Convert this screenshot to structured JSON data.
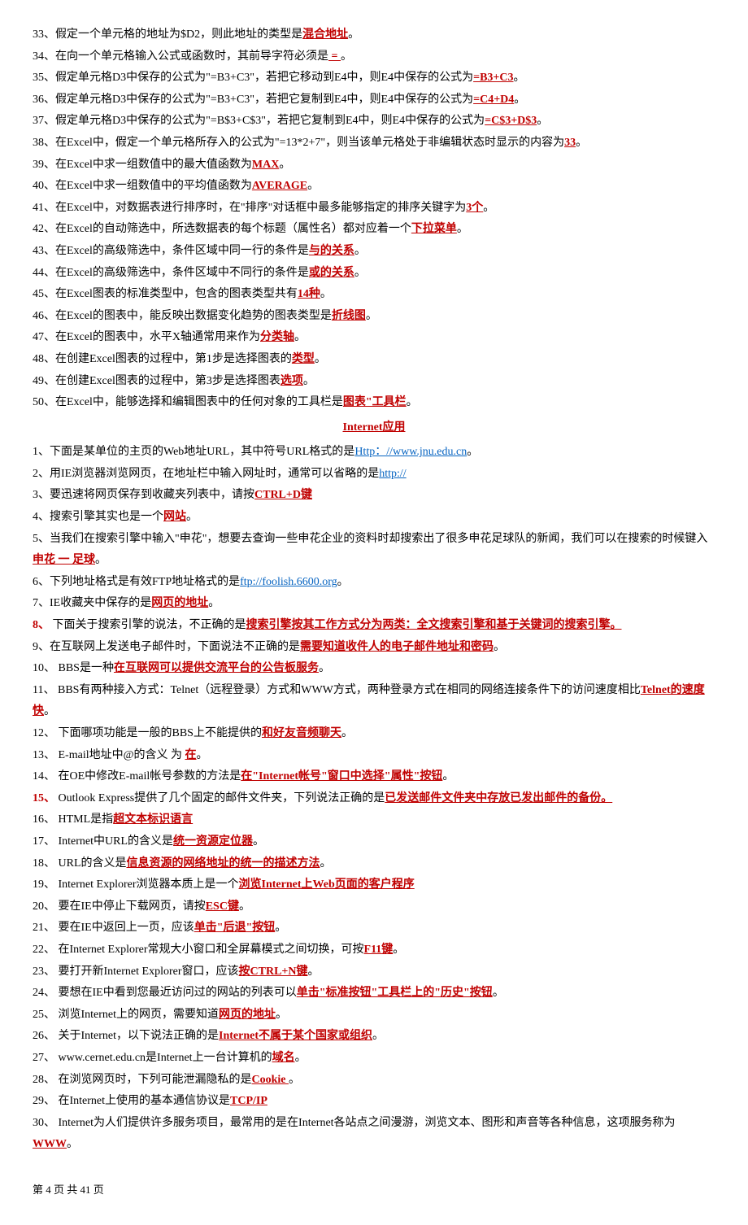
{
  "excel": [
    {
      "n": "33",
      "pre": "假定一个单元格的地址为$D2，则此地址的类型是",
      "ans": "混合地址",
      "post": "。"
    },
    {
      "n": "34",
      "pre": "在向一个单元格输入公式或函数时，其前导字符必须是",
      "ans": " = ",
      "post": "。"
    },
    {
      "n": "35",
      "pre": "假定单元格D3中保存的公式为\"=B3+C3\"，若把它移动到E4中，则E4中保存的公式为",
      "ans": "=B3+C3",
      "post": "。"
    },
    {
      "n": "36",
      "pre": "假定单元格D3中保存的公式为\"=B3+C3\"，若把它复制到E4中，则E4中保存的公式为",
      "ans": "=C4+D4",
      "post": "。"
    },
    {
      "n": "37",
      "pre": "假定单元格D3中保存的公式为\"=B$3+C$3\"，若把它复制到E4中，则E4中保存的公式为",
      "ans": "=C$3+D$3",
      "post": "。"
    },
    {
      "n": "38",
      "pre": "在Excel中，假定一个单元格所存入的公式为\"=13*2+7\"，则当该单元格处于非编辑状态时显示的内容为",
      "ans": "33",
      "post": "。"
    },
    {
      "n": "39",
      "pre": "在Excel中求一组数值中的最大值函数为",
      "ans": "MAX",
      "post": "。"
    },
    {
      "n": "40",
      "pre": "在Excel中求一组数值中的平均值函数为",
      "ans": "AVERAGE",
      "post": "。"
    },
    {
      "n": "41",
      "pre": "在Excel中，对数据表进行排序时，在\"排序\"对话框中最多能够指定的排序关键字为",
      "ans": "3个",
      "post": "。"
    },
    {
      "n": "42",
      "pre": "在Excel的自动筛选中，所选数据表的每个标题（属性名）都对应着一个",
      "ans": "下拉菜单",
      "post": "。"
    },
    {
      "n": "43",
      "pre": "在Excel的高级筛选中，条件区域中同一行的条件是",
      "ans": "与的关系",
      "post": "。"
    },
    {
      "n": "44",
      "pre": "在Excel的高级筛选中，条件区域中不同行的条件是",
      "ans": "或的关系",
      "post": "。"
    },
    {
      "n": "45",
      "pre": "在Excel图表的标准类型中，包含的图表类型共有",
      "ans": "14种",
      "post": "。"
    },
    {
      "n": "46",
      "pre": "在Excel的图表中，能反映出数据变化趋势的图表类型是",
      "ans": "折线图",
      "post": "。"
    },
    {
      "n": "47",
      "pre": "在Excel的图表中，水平X轴通常用来作为",
      "ans": "分类轴",
      "post": "。"
    },
    {
      "n": "48",
      "pre": "在创建Excel图表的过程中，第1步是选择图表的",
      "ans": "类型",
      "post": "。"
    },
    {
      "n": "49",
      "pre": "在创建Excel图表的过程中，第3步是选择图表",
      "ans": "选项",
      "post": "。"
    },
    {
      "n": "50",
      "pre": "在Excel中，能够选择和编辑图表中的任何对象的工具栏是",
      "ans": "图表\"工具栏",
      "post": "。"
    }
  ],
  "section_title": "Internet应用",
  "net": [
    {
      "n": "1",
      "pre": "下面是某单位的主页的Web地址URL，其中符号URL格式的是",
      "ans": "Http：//www.jnu.edu.cn",
      "post": "。",
      "linkStyle": "blue"
    },
    {
      "n": "2",
      "pre": "用IE浏览器浏览网页，在地址栏中输入网址时，通常可以省略的是",
      "ans": "http://",
      "post": "",
      "linkStyle": "blue"
    },
    {
      "n": "3",
      "pre": "要迅速将网页保存到收藏夹列表中，请按",
      "ans": "CTRL+D键",
      "post": ""
    },
    {
      "n": "4",
      "pre": "搜索引擎其实也是一个",
      "ans": "网站",
      "post": "。"
    },
    {
      "n": "5",
      "pre": "当我们在搜索引擎中输入\"申花\"，想要去查询一些申花企业的资料时却搜索出了很多申花足球队的新闻，我们可以在搜索的时候键入",
      "ans": "申花 一 足球",
      "post": "。"
    },
    {
      "n": "6",
      "pre": "下列地址格式是有效FTP地址格式的是",
      "ans": "ftp://foolish.6600.org",
      "post": "。",
      "linkStyle": "blue"
    },
    {
      "n": "7",
      "pre": "IE收藏夹中保存的是",
      "ans": "网页的地址",
      "post": "。"
    },
    {
      "n": "8",
      "numRed": true,
      "pre": " 下面关于搜索引擎的说法，不正确的是",
      "ans": "搜索引擎按其工作方式分为两类：全文搜索引擎和基于关键词的搜索引擎。",
      "post": ""
    },
    {
      "n": "9",
      "pre": "在互联网上发送电子邮件时，下面说法不正确的是",
      "ans": "需要知道收件人的电子邮件地址和密码",
      "post": "。"
    },
    {
      "n": "10",
      "pre": " BBS是一种",
      "ans": "在互联网可以提供交流平台的公告板服务",
      "post": "。"
    },
    {
      "n": "11",
      "pre": " BBS有两种接入方式：Telnet（远程登录）方式和WWW方式，两种登录方式在相同的网络连接条件下的访问速度相比",
      "ans": "Telnet的速度快",
      "post": "。"
    },
    {
      "n": "12",
      "pre": " 下面哪项功能是一般的BBS上不能提供的",
      "ans": "和好友音频聊天",
      "post": "。"
    },
    {
      "n": "13",
      "pre": " E-mail地址中@的含义 为 ",
      "ans": "在",
      "post": "。"
    },
    {
      "n": "14",
      "pre": " 在OE中修改E-mail帐号参数的方法是",
      "ans": "在\"Internet帐号\"窗口中选择\"属性\"按钮",
      "post": "。"
    },
    {
      "n": "15",
      "numRed": true,
      "pre": " Outlook Express提供了几个固定的邮件文件夹，下列说法正确的是",
      "ans": "已发送邮件文件夹中存放已发出邮件的备份。 ",
      "post": ""
    },
    {
      "n": "16",
      "pre": " HTML是指",
      "ans": "超文本标识语言",
      "post": ""
    },
    {
      "n": "17",
      "pre": " Internet中URL的含义是",
      "ans": "统一资源定位器",
      "post": "。"
    },
    {
      "n": "18",
      "pre": " URL的含义是",
      "ans": "信息资源的网络地址的统一的描述方法",
      "post": "。"
    },
    {
      "n": "19",
      "pre": " Internet Explorer浏览器本质上是一个",
      "ans": "浏览Internet上Web页面的客户程序",
      "post": ""
    },
    {
      "n": "20",
      "pre": " 要在IE中停止下载网页，请按",
      "ans": "ESC键",
      "post": "。"
    },
    {
      "n": "21",
      "pre": " 要在IE中返回上一页，应该",
      "ans": "单击\"后退\"按钮",
      "post": "。"
    },
    {
      "n": "22",
      "pre": " 在Internet Explorer常规大小窗口和全屏幕模式之间切换，可按",
      "ans": "F11键",
      "post": "。"
    },
    {
      "n": "23",
      "pre": " 要打开新Internet Explorer窗口，应该",
      "ans": "按CTRL+N键",
      "post": "。"
    },
    {
      "n": "24",
      "pre": " 要想在IE中看到您最近访问过的网站的列表可以",
      "ans": "单击\"标准按钮\"工具栏上的\"历史\"按钮",
      "post": "。"
    },
    {
      "n": "25",
      "pre": " 浏览Internet上的网页，需要知道",
      "ans": "网页的地址",
      "post": "。"
    },
    {
      "n": "26",
      "pre": " 关于Internet，以下说法正确的是",
      "ans": "Internet不属于某个国家或组织",
      "post": "。"
    },
    {
      "n": "27",
      "pre": " www.cernet.edu.cn是Internet上一台计算机的",
      "ans": "域名",
      "post": "。"
    },
    {
      "n": "28",
      "pre": " 在浏览网页时，下列可能泄漏隐私的是",
      "ans": "Cookie ",
      "post": "。"
    },
    {
      "n": "29",
      "pre": " 在Internet上使用的基本通信协议是",
      "ans": "TCP/IP",
      "post": ""
    },
    {
      "n": "30",
      "pre": " Internet为人们提供许多服务项目，最常用的是在Internet各站点之间漫游，浏览文本、图形和声音等各种信息，这项服务称为",
      "ans": "WWW",
      "post": "。"
    }
  ],
  "footer": "第 4 页 共 41 页"
}
